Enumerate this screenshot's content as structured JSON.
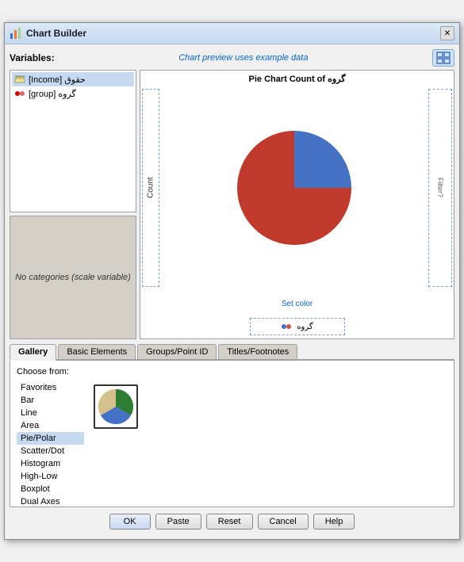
{
  "window": {
    "title": "Chart Builder",
    "close_label": "✕"
  },
  "header": {
    "variables_label": "Variables:",
    "preview_note": "Chart preview uses example data",
    "expand_icon": "⊞"
  },
  "variables": {
    "items": [
      {
        "label": "[Income] حقوق",
        "type": "ruler",
        "selected": true
      },
      {
        "label": "[group] گروه",
        "type": "group",
        "selected": false
      }
    ]
  },
  "categories": {
    "text": "No categories (scale variable)"
  },
  "chart": {
    "title": "Pie Chart Count of گروه",
    "y_axis": "Count",
    "right_label": "Filter?",
    "set_color": "Set color",
    "legend_text": "گروه"
  },
  "tabs": [
    {
      "id": "gallery",
      "label": "Gallery",
      "active": true
    },
    {
      "id": "basic",
      "label": "Basic Elements",
      "active": false
    },
    {
      "id": "groups",
      "label": "Groups/Point ID",
      "active": false
    },
    {
      "id": "titles",
      "label": "Titles/Footnotes",
      "active": false
    }
  ],
  "gallery": {
    "choose_from": "Choose from:",
    "chart_types": [
      {
        "label": "Favorites",
        "selected": false
      },
      {
        "label": "Bar",
        "selected": false
      },
      {
        "label": "Line",
        "selected": false
      },
      {
        "label": "Area",
        "selected": false
      },
      {
        "label": "Pie/Polar",
        "selected": true
      },
      {
        "label": "Scatter/Dot",
        "selected": false
      },
      {
        "label": "Histogram",
        "selected": false
      },
      {
        "label": "High-Low",
        "selected": false
      },
      {
        "label": "Boxplot",
        "selected": false
      },
      {
        "label": "Dual Axes",
        "selected": false
      }
    ]
  },
  "buttons": {
    "ok": "OK",
    "paste": "Paste",
    "reset": "Reset",
    "cancel": "Cancel",
    "help": "Help"
  },
  "colors": {
    "pie_blue": "#4472C4",
    "pie_red": "#C0392B",
    "pie_dark_green": "#2E7D32",
    "tab_active_bg": "#f0f0f0",
    "tab_inactive_bg": "#d4d0c8"
  }
}
